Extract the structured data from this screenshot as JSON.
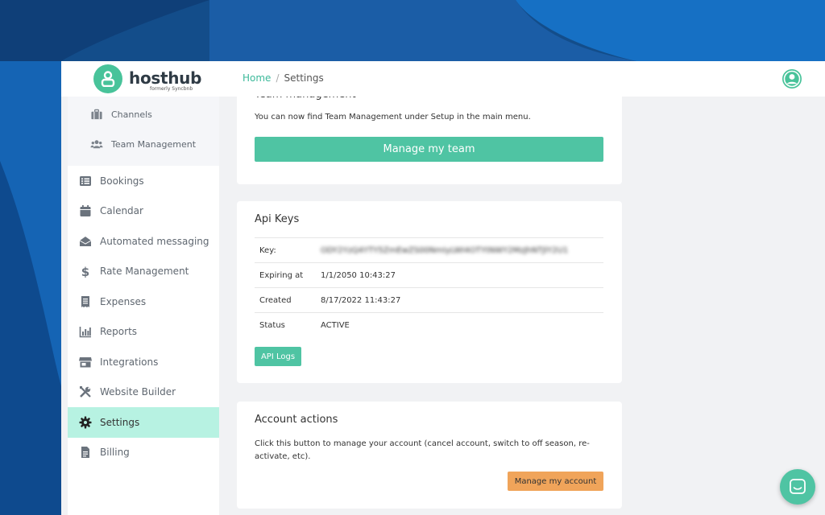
{
  "brand": {
    "name": "hosthub",
    "tagline": "formerly Syncbnb"
  },
  "breadcrumb": {
    "home": "Home",
    "separator": "/",
    "current": "Settings"
  },
  "sidebar": {
    "sub_items": [
      {
        "label": "Channels",
        "icon": "briefcase-icon"
      },
      {
        "label": "Team Management",
        "icon": "users-icon"
      }
    ],
    "items": [
      {
        "label": "Bookings",
        "icon": "list-icon"
      },
      {
        "label": "Calendar",
        "icon": "calendar-icon"
      },
      {
        "label": "Automated messaging",
        "icon": "envelope-icon"
      },
      {
        "label": "Rate Management",
        "icon": "dollar-icon"
      },
      {
        "label": "Expenses",
        "icon": "receipt-icon"
      },
      {
        "label": "Reports",
        "icon": "bar-chart-icon"
      },
      {
        "label": "Integrations",
        "icon": "store-icon"
      },
      {
        "label": "Website Builder",
        "icon": "tools-icon"
      },
      {
        "label": "Settings",
        "icon": "gear-icon",
        "active": true
      },
      {
        "label": "Billing",
        "icon": "file-icon"
      }
    ]
  },
  "team_card": {
    "title": "Team management",
    "description": "You can now find Team Management under Setup in the main menu.",
    "button": "Manage my team"
  },
  "api_card": {
    "title": "Api Keys",
    "rows": [
      {
        "label": "Key:",
        "value": "ODY2YzQ4YTY5ZmEwZS00NmIyLWI4OTYtNWY2MzJhNTJlY2U1"
      },
      {
        "label": "Expiring at",
        "value": "1/1/2050 10:43:27"
      },
      {
        "label": "Created",
        "value": "8/17/2022 11:43:27"
      },
      {
        "label": "Status",
        "value": "ACTIVE"
      }
    ],
    "button": "API Logs"
  },
  "account_card": {
    "title": "Account actions",
    "description": "Click this button to manage your account (cancel account, switch to off season, re-activate, etc).",
    "button": "Manage my account"
  },
  "colors": {
    "accent": "#4fc4a3",
    "active_nav": "#b7f2e2",
    "account_button": "#f0a45a",
    "background": "#1b5a9a"
  }
}
